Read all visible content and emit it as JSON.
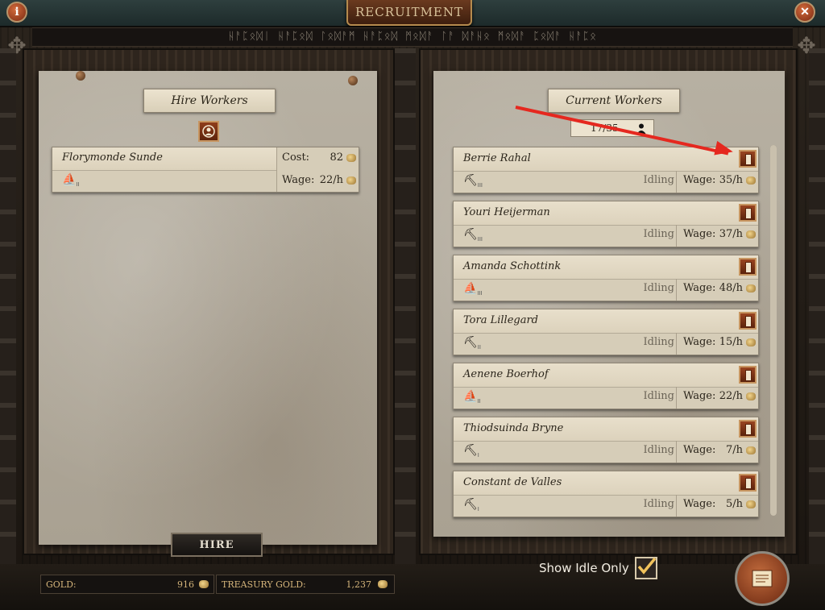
{
  "window": {
    "title": "Recruitment"
  },
  "runes": "ᚺᚨᛈᛟᛞᛁ ᚺᚨᛈᛟᛞ ᛚᛟᛞᚨᛗ ᚺᚨᛈᛟᛞ ᛗᛟᛞᚨ ᛚᚨ ᛞᚨᚺᛟ ᛗᛟᛞᚨ ᛈᛟᛞᚨ ᚺᚨᛈᛟ",
  "hire_panel": {
    "title": "Hire Workers",
    "candidate": {
      "name": "Florymonde Sunde",
      "cost_label": "Cost:",
      "cost": "82",
      "wage_label": "Wage:",
      "wage": "22/h",
      "tool": "⛵",
      "level": "II"
    },
    "hire_button": "HIRE"
  },
  "current_panel": {
    "title": "Current Workers",
    "count": "17/35",
    "workers": [
      {
        "name": "Berrie Rahal",
        "tool": "⛏",
        "level": "III",
        "status": "Idling",
        "wage_label": "Wage:",
        "wage": "35/h"
      },
      {
        "name": "Youri Heijerman",
        "tool": "⛏",
        "level": "III",
        "status": "Idling",
        "wage_label": "Wage:",
        "wage": "37/h"
      },
      {
        "name": "Amanda Schottink",
        "tool": "⛵",
        "level": "III",
        "status": "Idling",
        "wage_label": "Wage:",
        "wage": "48/h"
      },
      {
        "name": "Tora Lillegard",
        "tool": "⛏",
        "level": "II",
        "status": "Idling",
        "wage_label": "Wage:",
        "wage": "15/h"
      },
      {
        "name": "Aenene Boerhof",
        "tool": "⛵",
        "level": "II",
        "status": "Idling",
        "wage_label": "Wage:",
        "wage": "22/h"
      },
      {
        "name": "Thiodsuinda Bryne",
        "tool": "⛏",
        "level": "I",
        "status": "Idling",
        "wage_label": "Wage:",
        "wage": "7/h"
      },
      {
        "name": "Constant de Valles",
        "tool": "⛏",
        "level": "I",
        "status": "Idling",
        "wage_label": "Wage:",
        "wage": "5/h"
      }
    ]
  },
  "footer": {
    "gold_label": "Gold:",
    "gold_value": "916",
    "treasury_label": "Treasury Gold:",
    "treasury_value": "1,237",
    "show_idle_label": "Show Idle Only",
    "show_idle_checked": true
  },
  "icons": {
    "info": "info-icon",
    "close": "close-icon",
    "worker": "worker-portrait-icon",
    "dismiss": "dismiss-worker-icon",
    "coin": "gold-coin-icon",
    "scroll": "scroll-icon"
  },
  "colors": {
    "arrow": "#e5281f",
    "accent": "#9a4521",
    "gold_text": "#d4b47a"
  }
}
